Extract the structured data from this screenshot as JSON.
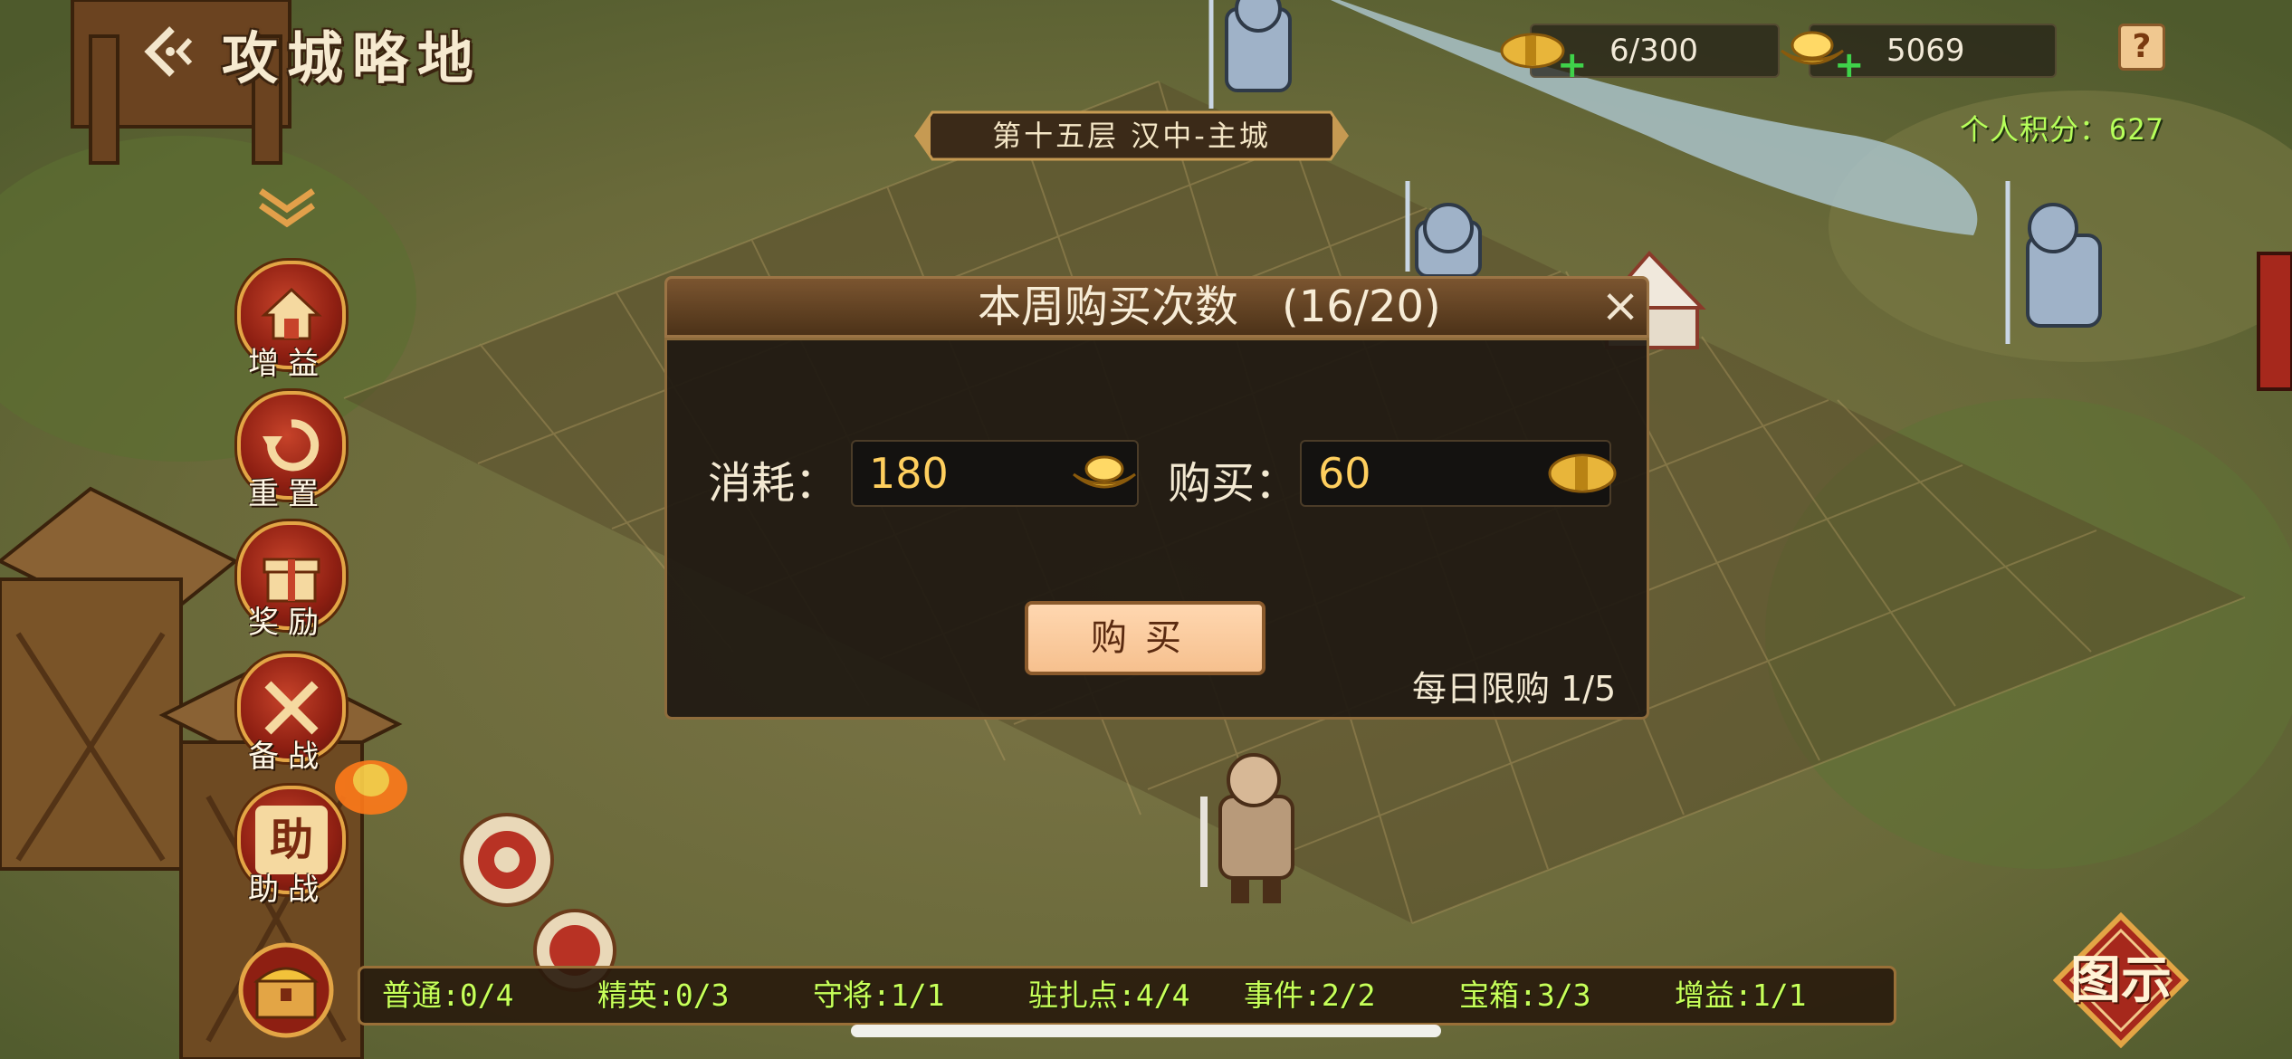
{
  "header": {
    "title": "攻城略地",
    "floor": "第十五层 汉中-主城",
    "personal_score": "个人积分：627"
  },
  "resources": {
    "grain": "6/300",
    "gold": "5069",
    "help": "?"
  },
  "side_menu": [
    {
      "label": "增益",
      "icon": "house-icon"
    },
    {
      "label": "重置",
      "icon": "reset-icon"
    },
    {
      "label": "奖励",
      "icon": "gift-icon"
    },
    {
      "label": "备战",
      "icon": "crossed-swords-icon"
    },
    {
      "label": "助战",
      "icon": "assist-icon",
      "glyph": "助"
    }
  ],
  "dialog": {
    "title": "本周购买次数　(16/20)",
    "close": "×",
    "cost_label": "消耗：",
    "cost_value": "180",
    "buy_label": "购买：",
    "buy_value": "60",
    "buy_button": "购买",
    "daily_limit": "每日限购 1/5"
  },
  "bottom_stats": [
    "普通:0/4",
    "精英:0/3",
    "守将:1/1",
    "驻扎点:4/4",
    "事件:2/2",
    "宝箱:3/3",
    "增益:1/1"
  ],
  "legend_button": "图示",
  "colors": {
    "accent_gold": "#ffcf5e",
    "score_green": "#b6ff5a",
    "button_peach": "#f6c08e"
  }
}
